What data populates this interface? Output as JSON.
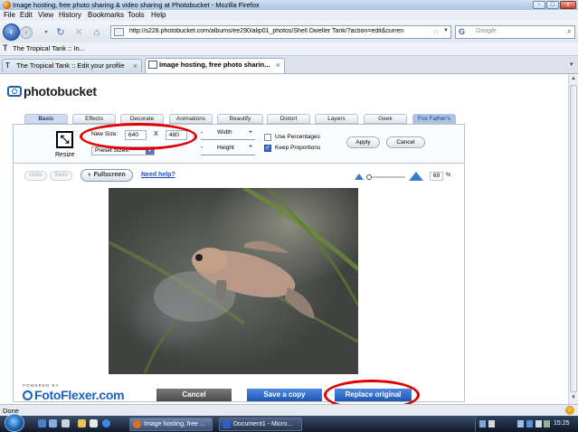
{
  "window": {
    "title": "Image hosting, free photo sharing & video sharing at Photobucket - Mozilla Firefox",
    "controls": [
      "-",
      "□",
      "x"
    ]
  },
  "menu": [
    "File",
    "Edit",
    "View",
    "History",
    "Bookmarks",
    "Tools",
    "Help"
  ],
  "navbar": {
    "url": "http://s228.photobucket.com/albums/ee290/alip01_photos/Shell Dweller Tank/?action=edit&curren",
    "search_placeholder": "Google",
    "search_engine": "G"
  },
  "bookmarks": {
    "item": "The Tropical Tank :: In..."
  },
  "tabs": [
    {
      "label": "The Tropical Tank :: Edit your profile",
      "active": false
    },
    {
      "label": "Image hosting, free photo sharin...",
      "active": true
    }
  ],
  "page": {
    "logo": "photobucket",
    "editor_tabs": [
      "Basic",
      "Effects",
      "Decorate",
      "Animations",
      "Beautify",
      "Distort",
      "Layers",
      "Geek",
      "Fox Father's"
    ],
    "resize": {
      "icon_label": "Resize",
      "new_size_label": "New Size:",
      "width_value": "640",
      "x_label": "X",
      "height_value": "480",
      "preset_label": "Preset Sizes:",
      "width_label": "Width",
      "height_label": "Height",
      "minus": "-",
      "plus": "+",
      "use_percentages": "Use Percentages",
      "use_percentages_checked": false,
      "keep_proportions": "Keep Proportions",
      "keep_proportions_checked": true,
      "apply": "Apply",
      "cancel": "Cancel"
    },
    "toolbar": {
      "undo": "Undo",
      "redo": "Redo",
      "fullscreen": "Fullscreen",
      "need_help": "Need help?",
      "zoom_value": "69",
      "zoom_unit": "%"
    },
    "bottom": {
      "powered_by": "POWERED BY",
      "brand": "FotoFlexer.com",
      "cancel": "Cancel",
      "save_copy": "Save a copy",
      "replace_original": "Replace original"
    }
  },
  "status": {
    "text": "Done"
  },
  "taskbar": {
    "items": [
      "Image hosting, free ...",
      "Document1 - Micro..."
    ],
    "clock": "15:25"
  },
  "colors": {
    "annotation_red": "#e00000",
    "cancel_btn": "#5a5a5a",
    "save_btn": "#2a66c4",
    "replace_btn": "#2a66c4",
    "brand_blue": "#1a63b8"
  }
}
